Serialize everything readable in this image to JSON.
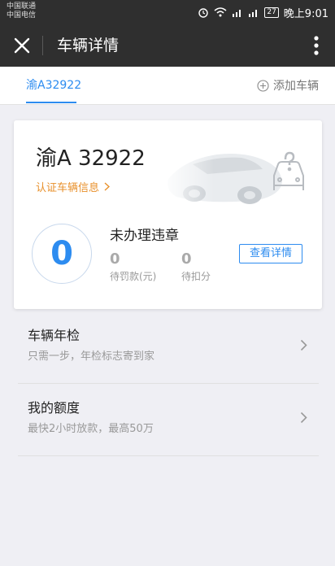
{
  "status_bar": {
    "carrier1": "中国联通",
    "carrier2": "中国电信",
    "battery": "27",
    "time": "晚上9:01"
  },
  "titlebar": {
    "title": "车辆详情"
  },
  "tabs": {
    "active": "渝A32922",
    "add_label": "添加车辆"
  },
  "card": {
    "plate": "渝A 32922",
    "verify_link": "认证车辆信息",
    "violation_count": "0",
    "status": "未办理违章",
    "fine_value": "0",
    "fine_label": "待罚款(元)",
    "points_value": "0",
    "points_label": "待扣分",
    "detail_button": "查看详情"
  },
  "list": [
    {
      "title": "车辆年检",
      "subtitle": "只需一步，年检标志寄到家"
    },
    {
      "title": "我的额度",
      "subtitle": "最快2小时放款，最高50万"
    }
  ],
  "colors": {
    "accent": "#2d8cf0",
    "link": "#e8902b",
    "header": "#2f2f2f"
  }
}
